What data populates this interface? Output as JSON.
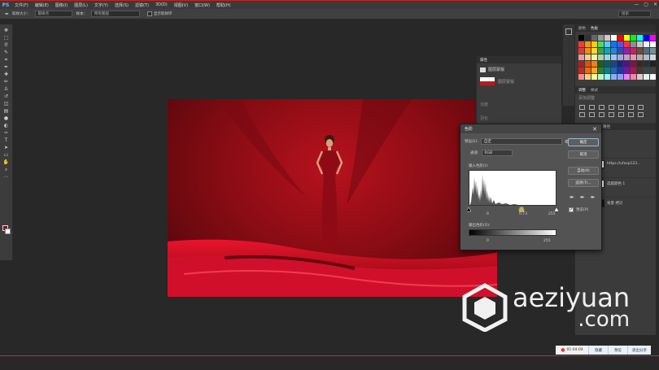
{
  "app": {
    "logo": "PS"
  },
  "menu": [
    "文件(F)",
    "编辑(E)",
    "图像(I)",
    "图层(L)",
    "文字(Y)",
    "选择(S)",
    "滤镜(T)",
    "3D(D)",
    "视图(V)",
    "窗口(W)",
    "帮助(H)"
  ],
  "window_controls": [
    "—",
    "▢",
    "✕"
  ],
  "options_bar": {
    "brush_size_label": "取样大小：",
    "brush_size_value": "取样点",
    "sample_label": "样本：",
    "sample_value": "所有图层",
    "show_ring_label": "显示取样环",
    "search_placeholder": "搜索"
  },
  "tools": [
    "move-icon",
    "marquee-icon",
    "lasso-icon",
    "quick-select-icon",
    "crop-icon",
    "eyedropper-icon",
    "heal-icon",
    "brush-icon",
    "stamp-icon",
    "history-brush-icon",
    "eraser-icon",
    "gradient-icon",
    "blur-icon",
    "dodge-icon",
    "pen-icon",
    "type-icon",
    "path-select-icon",
    "shape-icon",
    "hand-icon",
    "zoom-icon",
    "more-icon"
  ],
  "tool_glyphs": [
    "✥",
    "⬚",
    "ᘓ",
    "✎",
    "⌗",
    "✒",
    "✚",
    "✏",
    "♙",
    "↺",
    "◫",
    "▤",
    "●",
    "◐",
    "✑",
    "T",
    "➤",
    "▭",
    "✋",
    "⌕",
    "⋯"
  ],
  "properties": {
    "tab": "属性",
    "layer_label": "图层蒙版",
    "sub_label": "浓度",
    "sub_label2": "羽化"
  },
  "right_panels": {
    "swatches_tabs": [
      "颜色",
      "色板"
    ],
    "adjust_tabs": [
      "调整",
      "样式"
    ],
    "adjust_label": "添加调整",
    "layers_tabs": [
      "图层",
      "通道",
      "路径"
    ],
    "layers": [
      {
        "name": "https://ufasp123..."
      },
      {
        "name": "选取颜色 1"
      },
      {
        "name": "背景 拷贝"
      }
    ],
    "layer_side_labels": [
      "图层 2",
      "图层 1",
      "背景"
    ]
  },
  "swatch_colors": [
    "#000000",
    "#333333",
    "#666666",
    "#999999",
    "#cccccc",
    "#ffffff",
    "#ff0000",
    "#ffff00",
    "#00ff00",
    "#00ffff",
    "#0000ff",
    "#ff00ff",
    "#ff3b30",
    "#ff9500",
    "#ffcc00",
    "#4cd964",
    "#5ac8fa",
    "#007aff",
    "#5856d6",
    "#ff2d55",
    "#8e8e93",
    "#c7c7cc",
    "#efeff4",
    "#ffffff",
    "#e53935",
    "#fb8c00",
    "#fdd835",
    "#43a047",
    "#00acc1",
    "#1e88e5",
    "#3949ab",
    "#8e24aa",
    "#d81b60",
    "#6d4c41",
    "#546e7a",
    "#78909c",
    "#ef9a9a",
    "#ffcc80",
    "#fff59d",
    "#a5d6a7",
    "#80deea",
    "#90caf9",
    "#9fa8da",
    "#ce93d8",
    "#f48fb1",
    "#bcaaa4",
    "#b0bec5",
    "#cfd8dc",
    "#b71c1c",
    "#e65100",
    "#f57f17",
    "#1b5e20",
    "#006064",
    "#0d47a1",
    "#1a237e",
    "#4a148c",
    "#880e4f",
    "#3e2723",
    "#263238",
    "#212121",
    "#c62828",
    "#ef6c00",
    "#f9a825",
    "#2e7d32",
    "#00838f",
    "#1565c0",
    "#283593",
    "#6a1b9a",
    "#ad1457",
    "#4e342e",
    "#37474f",
    "#424242",
    "#ff8a80",
    "#ffd180",
    "#ffff8d",
    "#b9f6ca",
    "#84ffff",
    "#82b1ff",
    "#8c9eff",
    "#ea80fc",
    "#ff80ab",
    "#d7ccc8",
    "#eceff1",
    "#fafafa"
  ],
  "levels_dialog": {
    "title": "色阶",
    "close": "✕",
    "preset_label": "预设(E):",
    "preset_value": "自定",
    "channel_label": "通道:",
    "channel_value": "RGB",
    "input_label": "输入色阶(I):",
    "input_values": [
      "0",
      "0.73",
      "255"
    ],
    "output_label": "输出色阶(O):",
    "output_values": [
      "0",
      "255"
    ],
    "buttons": {
      "ok": "确定",
      "cancel": "取消",
      "auto": "自动(A)",
      "options": "选项(T)..."
    },
    "preview_label": "预览(P)",
    "preview_checked": "✓"
  },
  "status_bar": {
    "time": "01:04:04",
    "buttons": [
      "隐藏",
      "预览",
      "退出分享"
    ]
  },
  "watermark": {
    "text": "aeziyuan",
    "domain": ".com"
  }
}
